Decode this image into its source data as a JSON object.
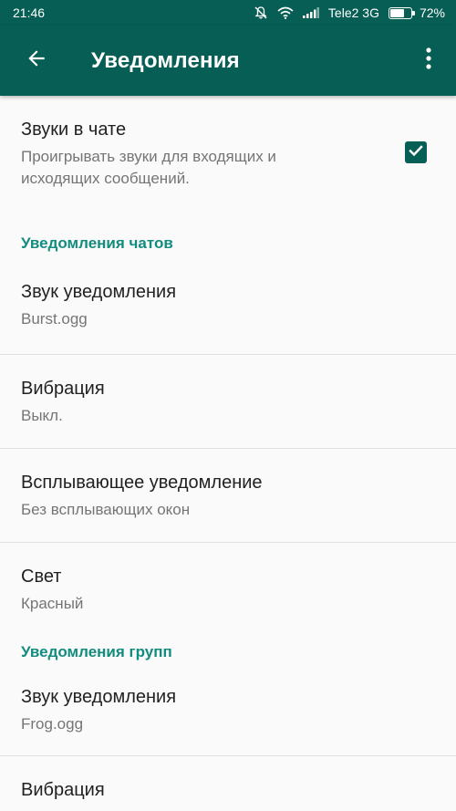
{
  "status_bar": {
    "time": "21:46",
    "carrier": "Tele2 3G",
    "battery_percent": "72%",
    "battery_level": 0.72,
    "icons": [
      "muted-bell-icon",
      "wifi-icon",
      "signal-icon",
      "battery-icon"
    ]
  },
  "toolbar": {
    "title": "Уведомления",
    "back_icon": "arrow-left-icon",
    "menu_icon": "more-vert-icon",
    "color": "#075e54"
  },
  "chat_sounds": {
    "title": "Звуки в чате",
    "summary": "Проигрывать звуки для входящих и исходящих сообщений.",
    "checked": true
  },
  "chat_notifications": {
    "header": "Уведомления чатов",
    "items": [
      {
        "title": "Звук уведомления",
        "value": "Burst.ogg"
      },
      {
        "title": "Вибрация",
        "value": "Выкл."
      },
      {
        "title": "Всплывающее уведомление",
        "value": "Без всплывающих окон"
      },
      {
        "title": "Свет",
        "value": "Красный"
      }
    ]
  },
  "group_notifications": {
    "header": "Уведомления групп",
    "items": [
      {
        "title": "Звук уведомления",
        "value": "Frog.ogg"
      },
      {
        "title": "Вибрация",
        "value": ""
      }
    ]
  },
  "colors": {
    "accent": "#128c7e",
    "primary": "#075e54"
  }
}
